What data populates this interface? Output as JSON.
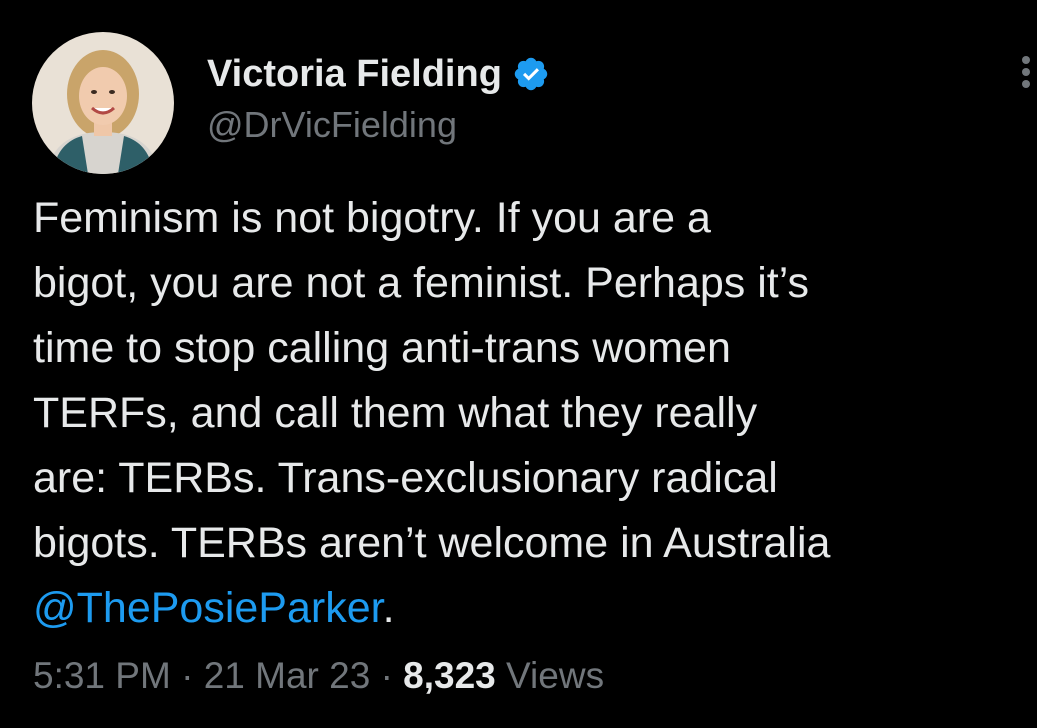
{
  "author": {
    "display_name": "Victoria Fielding",
    "handle": "@DrVicFielding",
    "verified": true
  },
  "tweet": {
    "text_lines": [
      "Feminism is not bigotry. If you are a",
      "bigot, you are not a feminist. Perhaps it’s",
      "time to stop calling anti-trans women",
      "TERFs, and call them what they really",
      "are: TERBs. Trans-exclusionary radical",
      "bigots. TERBs aren’t welcome in Australia"
    ],
    "mention": "@ThePosieParker",
    "trailing": ".",
    "time": "5:31 PM",
    "separator": "·",
    "date": "21 Mar 23",
    "views_count": "8,323",
    "views_label": "Views"
  },
  "colors": {
    "background": "#000000",
    "text": "#e7e9ea",
    "secondary": "#71767b",
    "accent": "#1d9bf0"
  },
  "icons": {
    "verified": "verified-badge-icon",
    "more": "more-options-icon"
  }
}
